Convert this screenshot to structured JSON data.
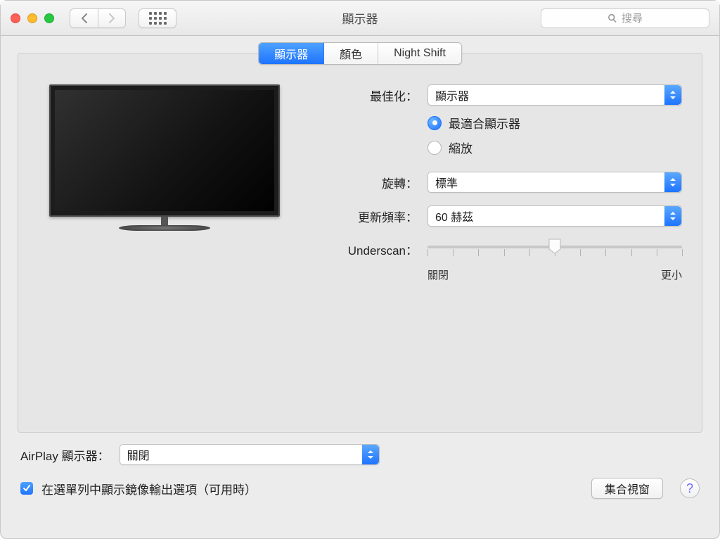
{
  "window": {
    "title": "顯示器"
  },
  "search": {
    "placeholder": "搜尋"
  },
  "tabs": [
    {
      "label": "顯示器",
      "active": true
    },
    {
      "label": "顏色",
      "active": false
    },
    {
      "label": "Night Shift",
      "active": false
    }
  ],
  "form": {
    "optimize": {
      "label": "最佳化：",
      "value": "顯示器"
    },
    "resolution_radios": {
      "best_label": "最適合顯示器",
      "scaled_label": "縮放",
      "selected": "best"
    },
    "rotation": {
      "label": "旋轉：",
      "value": "標準"
    },
    "refresh": {
      "label": "更新頻率：",
      "value": "60 赫茲"
    },
    "underscan": {
      "label": "Underscan：",
      "min_label": "關閉",
      "max_label": "更小",
      "value_pct": 50
    }
  },
  "airplay": {
    "label": "AirPlay 顯示器：",
    "value": "關閉"
  },
  "mirror_checkbox": {
    "label": "在選單列中顯示鏡像輸出選項（可用時）",
    "checked": true
  },
  "gather_button": {
    "label": "集合視窗"
  }
}
